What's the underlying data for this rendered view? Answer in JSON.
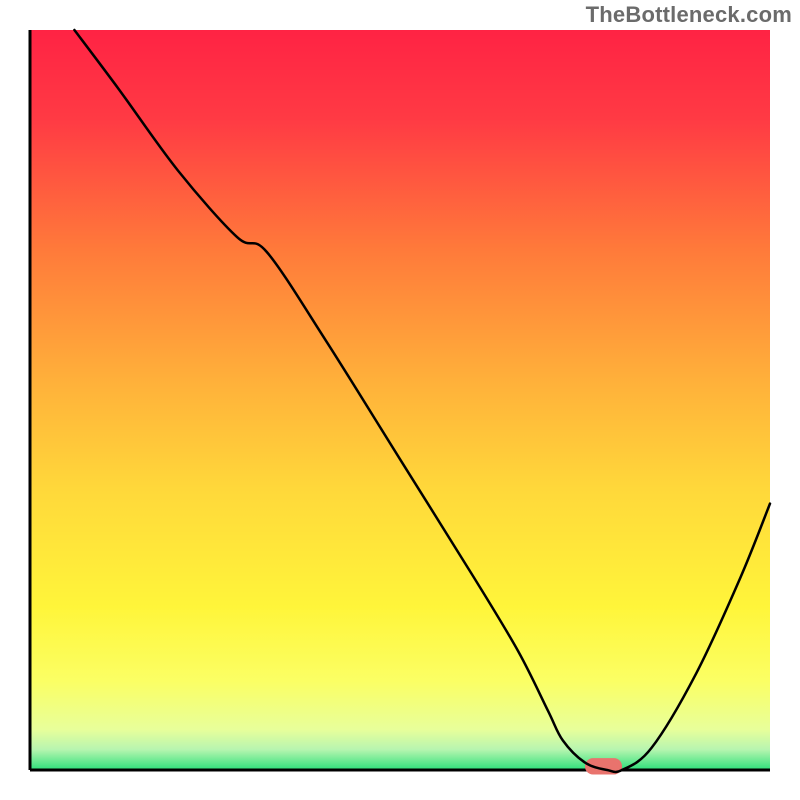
{
  "watermark": "TheBottleneck.com",
  "chart_data": {
    "type": "line",
    "title": "",
    "xlabel": "",
    "ylabel": "",
    "xlim": [
      0,
      100
    ],
    "ylim": [
      0,
      100
    ],
    "grid": false,
    "legend": false,
    "background_gradient_stops": [
      {
        "offset": 0.0,
        "color": "#ff2344"
      },
      {
        "offset": 0.12,
        "color": "#ff3a44"
      },
      {
        "offset": 0.3,
        "color": "#ff7b3a"
      },
      {
        "offset": 0.48,
        "color": "#ffb23a"
      },
      {
        "offset": 0.62,
        "color": "#ffd83a"
      },
      {
        "offset": 0.78,
        "color": "#fff53a"
      },
      {
        "offset": 0.88,
        "color": "#fbff64"
      },
      {
        "offset": 0.945,
        "color": "#e8ff9a"
      },
      {
        "offset": 0.972,
        "color": "#b8f5b0"
      },
      {
        "offset": 1.0,
        "color": "#2de07a"
      }
    ],
    "series": [
      {
        "name": "bottleneck-curve",
        "color": "#000000",
        "x": [
          6,
          12,
          20,
          28,
          32,
          40,
          50,
          60,
          66,
          70,
          72,
          75,
          78,
          80,
          84,
          90,
          96,
          100
        ],
        "values": [
          100,
          92,
          81,
          72,
          70,
          58,
          42,
          26,
          16,
          8,
          4,
          1,
          0,
          0,
          3,
          13,
          26,
          36
        ]
      }
    ],
    "markers": [
      {
        "name": "optimal-range",
        "shape": "rounded-bar",
        "color": "#e9736d",
        "x_start": 75,
        "x_end": 80,
        "y": 0.5,
        "height": 2.2
      }
    ],
    "axes": {
      "left": {
        "visible": true,
        "color": "#000000"
      },
      "bottom": {
        "visible": true,
        "color": "#000000"
      },
      "ticks": []
    }
  }
}
